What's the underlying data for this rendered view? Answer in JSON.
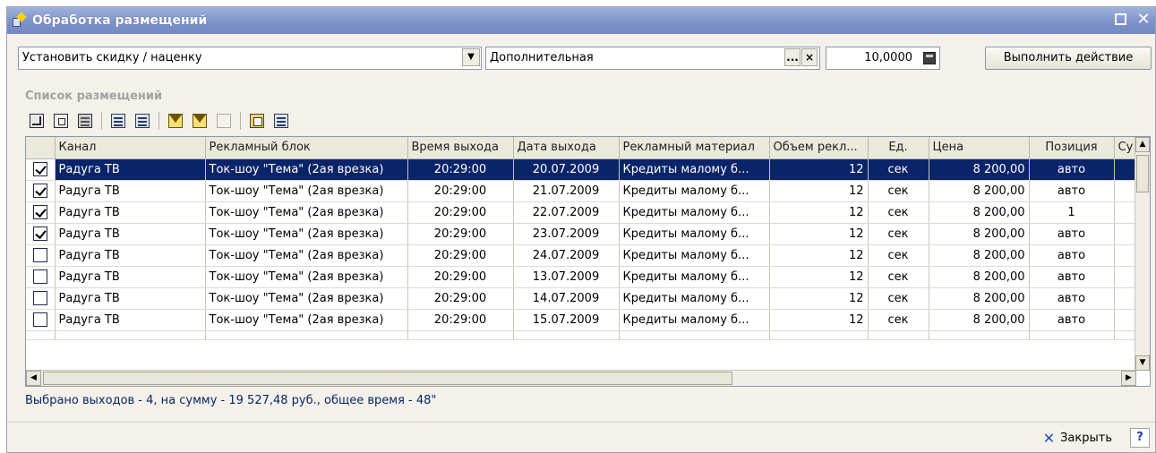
{
  "window": {
    "title": "Обработка размещений"
  },
  "controls": {
    "action_combo_value": "Установить скидку / наценку",
    "type_combo_value": "Дополнительная",
    "type_combo_ellipsis": "...",
    "type_combo_clear": "×",
    "amount_value": "10,0000",
    "execute_button": "Выполнить действие"
  },
  "section_label": "Список размещений",
  "grid": {
    "columns": [
      "Канал",
      "Рекламный блок",
      "Время выхода",
      "Дата выхода",
      "Рекламный материал",
      "Объем рекл...",
      "Ед.",
      "Цена",
      "Позиция",
      "Су"
    ],
    "rows": [
      {
        "checked": true,
        "channel": "Радуга ТВ",
        "block": "Ток-шоу \"Тема\" (2ая врезка)",
        "time": "20:29:00",
        "date": "20.07.2009",
        "material": "Кредиты малому б...",
        "volume": "12",
        "unit": "сек",
        "price": "8 200,00",
        "position": "авто"
      },
      {
        "checked": true,
        "channel": "Радуга ТВ",
        "block": "Ток-шоу \"Тема\" (2ая врезка)",
        "time": "20:29:00",
        "date": "21.07.2009",
        "material": "Кредиты малому б...",
        "volume": "12",
        "unit": "сек",
        "price": "8 200,00",
        "position": "авто"
      },
      {
        "checked": true,
        "channel": "Радуга ТВ",
        "block": "Ток-шоу \"Тема\" (2ая врезка)",
        "time": "20:29:00",
        "date": "22.07.2009",
        "material": "Кредиты малому б...",
        "volume": "12",
        "unit": "сек",
        "price": "8 200,00",
        "position": "1"
      },
      {
        "checked": true,
        "channel": "Радуга ТВ",
        "block": "Ток-шоу \"Тема\" (2ая врезка)",
        "time": "20:29:00",
        "date": "23.07.2009",
        "material": "Кредиты малому б...",
        "volume": "12",
        "unit": "сек",
        "price": "8 200,00",
        "position": "авто"
      },
      {
        "checked": false,
        "channel": "Радуга ТВ",
        "block": "Ток-шоу \"Тема\" (2ая врезка)",
        "time": "20:29:00",
        "date": "24.07.2009",
        "material": "Кредиты малому б...",
        "volume": "12",
        "unit": "сек",
        "price": "8 200,00",
        "position": "авто"
      },
      {
        "checked": false,
        "channel": "Радуга ТВ",
        "block": "Ток-шоу \"Тема\" (2ая врезка)",
        "time": "20:29:00",
        "date": "13.07.2009",
        "material": "Кредиты малому б...",
        "volume": "12",
        "unit": "сек",
        "price": "8 200,00",
        "position": "авто"
      },
      {
        "checked": false,
        "channel": "Радуга ТВ",
        "block": "Ток-шоу \"Тема\" (2ая врезка)",
        "time": "20:29:00",
        "date": "14.07.2009",
        "material": "Кредиты малому б...",
        "volume": "12",
        "unit": "сек",
        "price": "8 200,00",
        "position": "авто"
      },
      {
        "checked": false,
        "channel": "Радуга ТВ",
        "block": "Ток-шоу \"Тема\" (2ая врезка)",
        "time": "20:29:00",
        "date": "15.07.2009",
        "material": "Кредиты малому б...",
        "volume": "12",
        "unit": "сек",
        "price": "8 200,00",
        "position": "авто"
      }
    ],
    "selected_row": 0
  },
  "status": "Выбрано выходов - 4, на сумму - 19 527,48 руб., общее время - 48\"",
  "footer": {
    "close_label": "Закрыть",
    "help_label": "?"
  },
  "colors": {
    "titlebar": "#7d92c9",
    "selection": "#0a246a",
    "status_text": "#0a246a"
  },
  "icons": [
    "app-icon",
    "maximize-icon",
    "close-window-icon",
    "dropdown-arrow-icon",
    "calculator-icon",
    "check-all-icon",
    "copy-icon",
    "columns-icon",
    "sort-asc-icon",
    "sort-desc-icon",
    "filter-icon",
    "filter-edit-icon",
    "filter-clear-icon",
    "edit-icon",
    "list-icon",
    "close-icon",
    "help-icon"
  ]
}
